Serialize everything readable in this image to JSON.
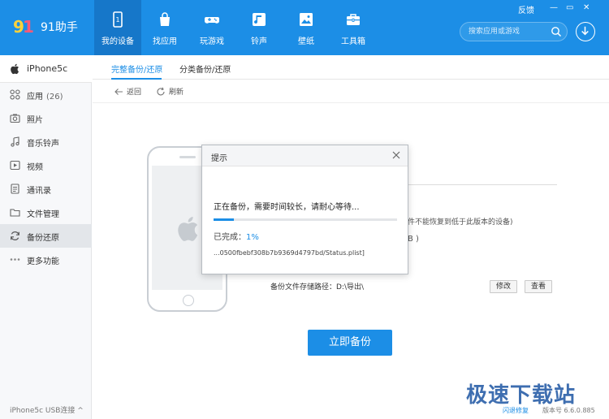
{
  "app": {
    "name": "91助手"
  },
  "nav": [
    {
      "label": "我的设备",
      "icon": "device-icon",
      "active": true
    },
    {
      "label": "找应用",
      "icon": "bag-icon"
    },
    {
      "label": "玩游戏",
      "icon": "gamepad-icon"
    },
    {
      "label": "铃声",
      "icon": "music-icon"
    },
    {
      "label": "壁纸",
      "icon": "picture-icon"
    },
    {
      "label": "工具箱",
      "icon": "toolbox-icon"
    }
  ],
  "window": {
    "feedback": "反馈",
    "minimize": "—",
    "restore": "▭",
    "close": "✕"
  },
  "search": {
    "placeholder": "搜索应用或游戏"
  },
  "sidebar": {
    "device": "iPhone5c",
    "items": [
      {
        "label": "应用",
        "count": "(26)",
        "icon": "apps-icon"
      },
      {
        "label": "照片",
        "icon": "camera-icon"
      },
      {
        "label": "音乐铃声",
        "icon": "music-note-icon"
      },
      {
        "label": "视频",
        "icon": "video-icon"
      },
      {
        "label": "通讯录",
        "icon": "contacts-icon"
      },
      {
        "label": "文件管理",
        "icon": "folder-icon"
      },
      {
        "label": "备份还原",
        "icon": "refresh-icon",
        "active": true
      },
      {
        "label": "更多功能",
        "icon": "more-icon"
      }
    ],
    "footer": "iPhone5c   USB连接 ^"
  },
  "tabs": [
    {
      "label": "完整备份/还原",
      "active": true
    },
    {
      "label": "分类备份/还原"
    }
  ],
  "toolbar": {
    "back": "返回",
    "refresh": "刷新"
  },
  "content": {
    "note_fragment": "件不能恢复到低于此版本的设备)",
    "size_fragment": "B )",
    "path_label": "备份文件存储路径：D:\\导出\\",
    "modify": "修改",
    "view": "查看",
    "backup_now": "立即备份"
  },
  "dialog": {
    "title": "提示",
    "message": "正在备份，需要时间较长，请耐心等待...",
    "progress": 0.01,
    "progress_label": "已完成：",
    "progress_value": "1%",
    "file": "...0500fbebf308b7b9369d4797bd/Status.plist]"
  },
  "status": {
    "repair": "闪退修复",
    "version": "版本号 6.6.0.885"
  },
  "watermark": "极速下载站",
  "colors": {
    "accent": "#1c8ee6"
  }
}
